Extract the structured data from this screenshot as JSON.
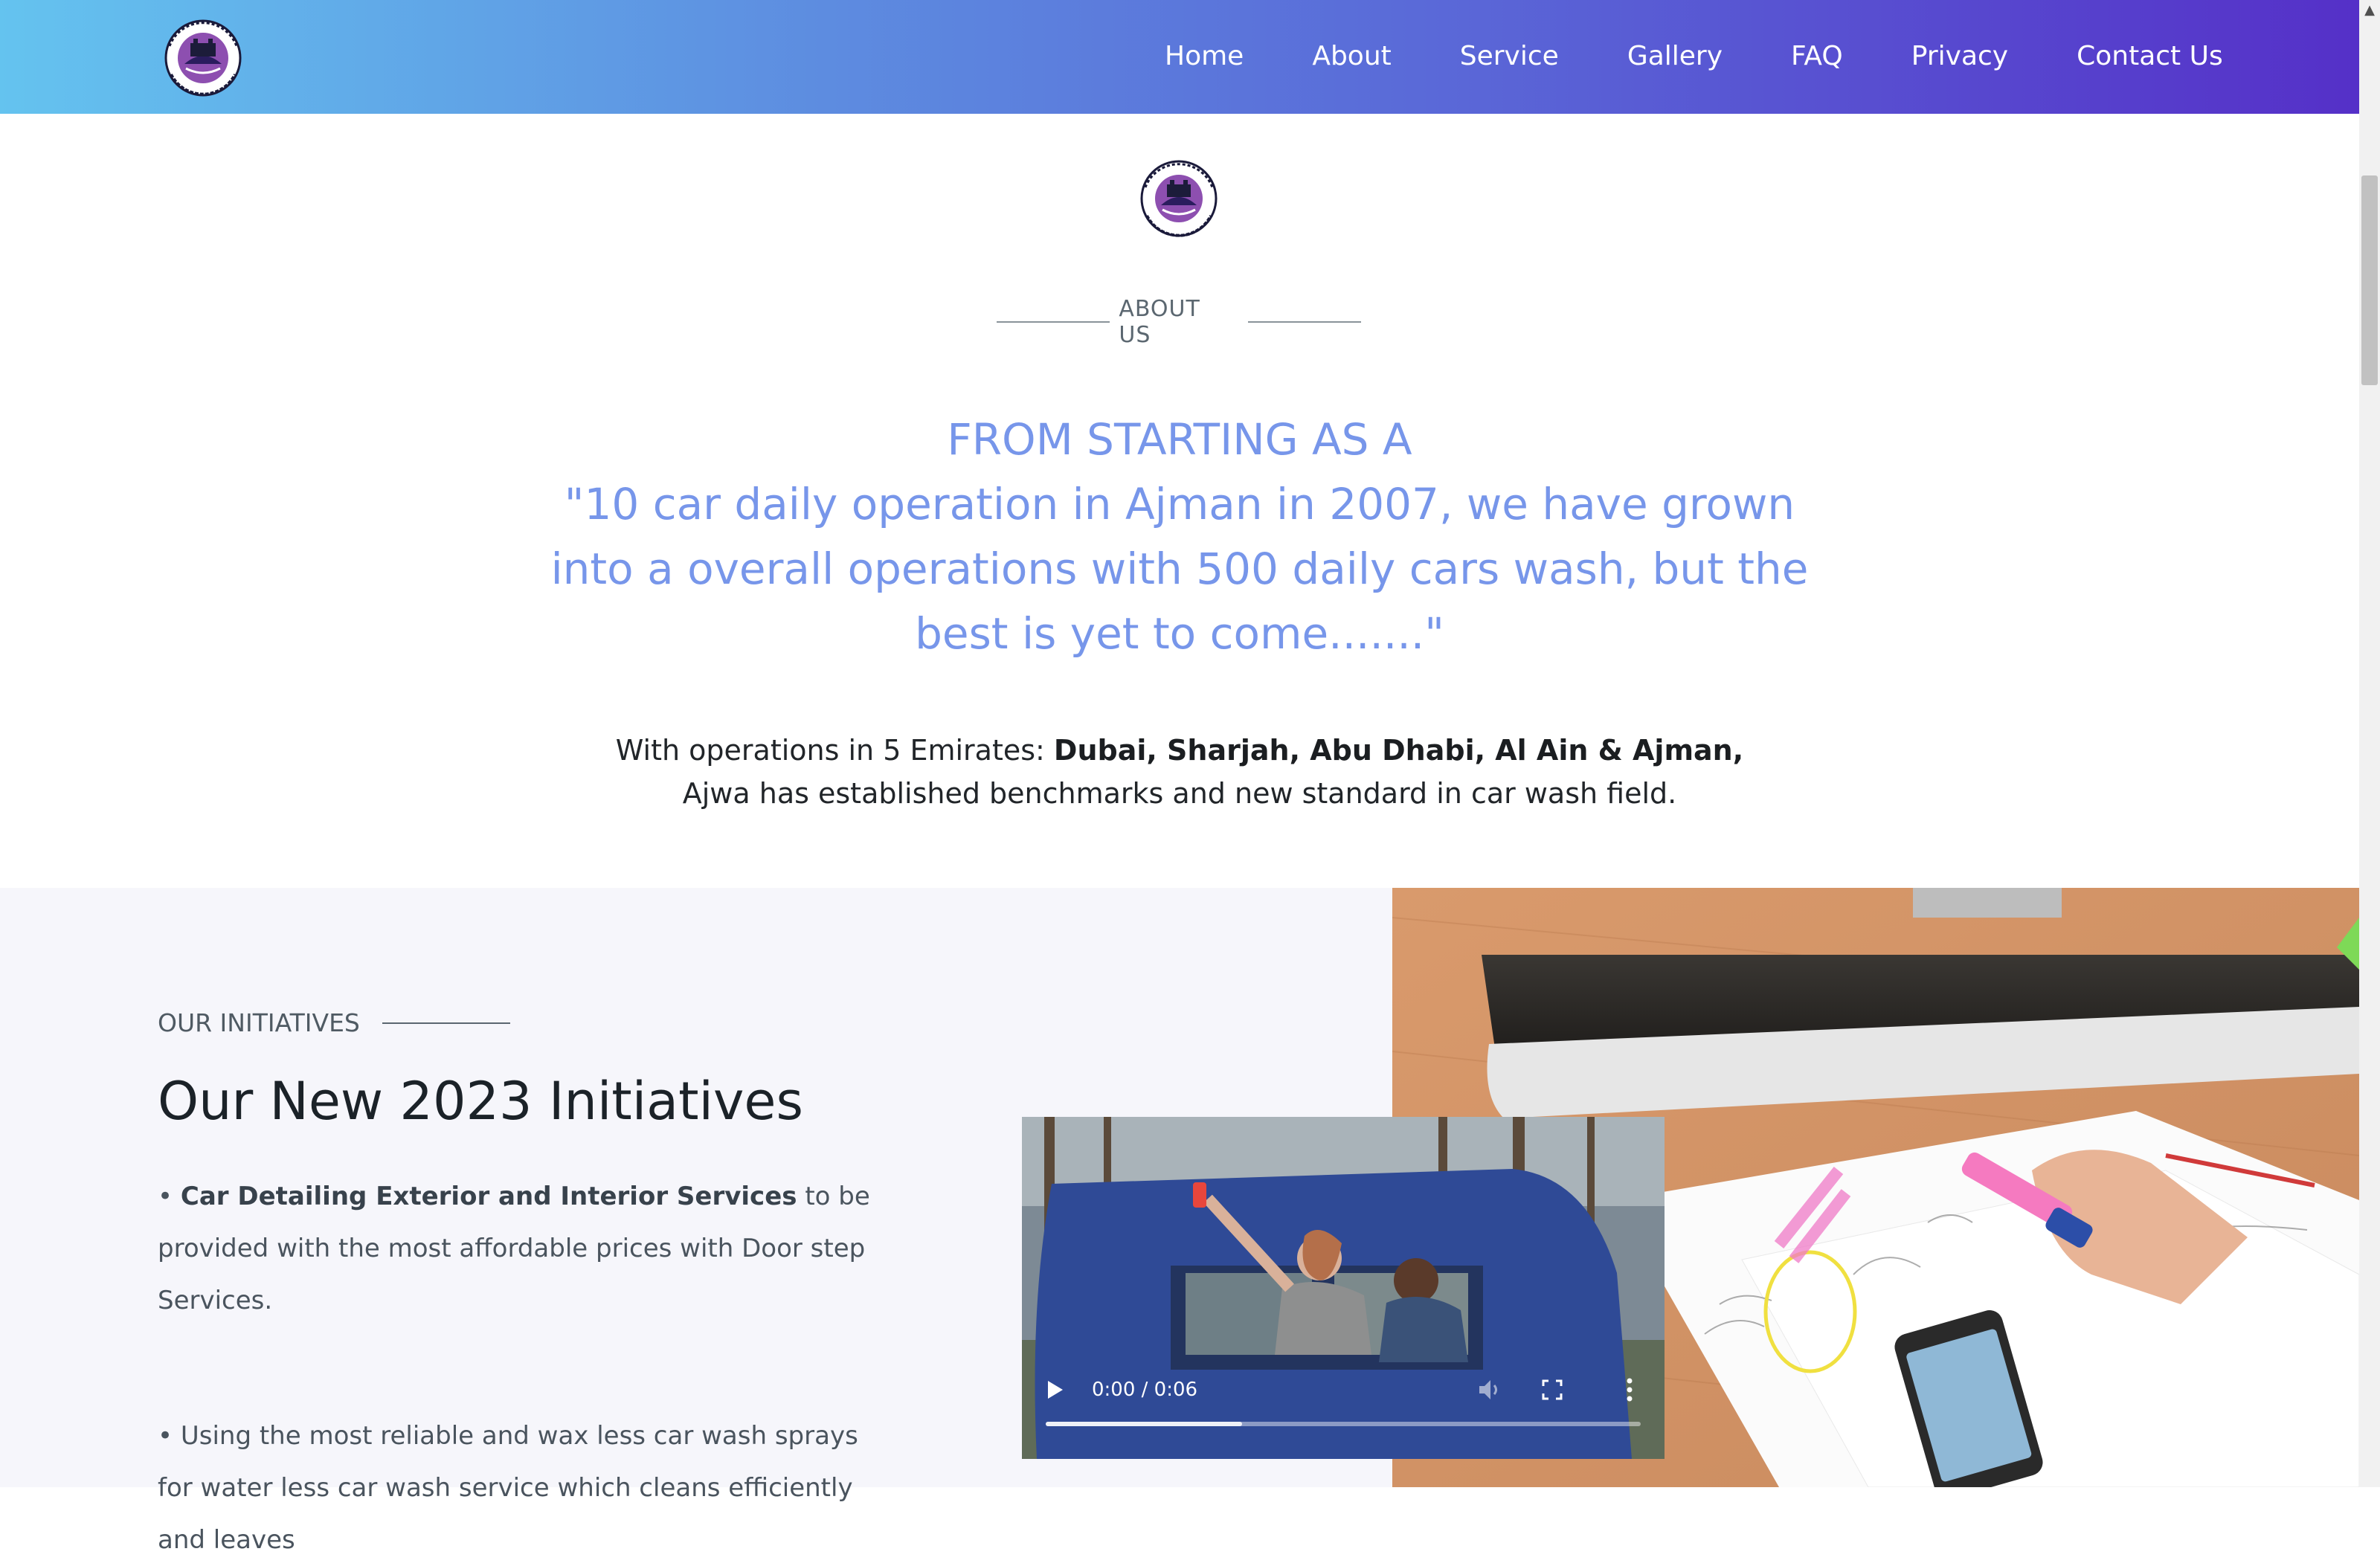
{
  "header": {
    "logo_alt": "AJWA AL SALAM CAR WASH",
    "nav": [
      {
        "label": "Home"
      },
      {
        "label": "About"
      },
      {
        "label": "Service"
      },
      {
        "label": "Gallery"
      },
      {
        "label": "FAQ"
      },
      {
        "label": "Privacy"
      },
      {
        "label": "Contact Us"
      }
    ]
  },
  "about": {
    "logo_text": "AJWA AL SALAM CAR WASH",
    "eyebrow": "ABOUT US",
    "headline_line1": "FROM STARTING AS A",
    "headline_line2": "\"10 car daily operation in Ajman in 2007, we have grown into a overall operations with 500 daily cars wash, but the best is yet to come.......\"",
    "operations_prefix": "With operations in 5 Emirates: ",
    "operations_bold": "Dubai, Sharjah, Abu Dhabi, Al Ain & Ajman,",
    "operations_suffix": " Ajwa has established benchmarks and new standard in car wash field."
  },
  "initiatives": {
    "eyebrow": "OUR INITIATIVES",
    "title": "Our New 2023 Initiatives",
    "bullet1_marker": "•",
    "bullet1_bold": "Car Detailing Exterior and Interior Services",
    "bullet1_text": " to be provided with the most affordable prices with Door step Services.",
    "bullet2_marker": "•",
    "bullet2_text": " Using the most reliable and wax less car wash sprays for water less car wash service which cleans efficiently and leaves"
  },
  "video": {
    "time_display": "0:00 / 0:06",
    "progress": 0.33,
    "controls": {
      "play_icon": "play-icon",
      "volume_icon": "volume-icon",
      "fullscreen_icon": "fullscreen-icon",
      "more_icon": "more-options-icon"
    }
  },
  "colors": {
    "header_gradient_start": "#64c3ef",
    "header_gradient_end": "#5530c8",
    "headline": "#7796ea",
    "section_bg": "#f6f6fb"
  }
}
